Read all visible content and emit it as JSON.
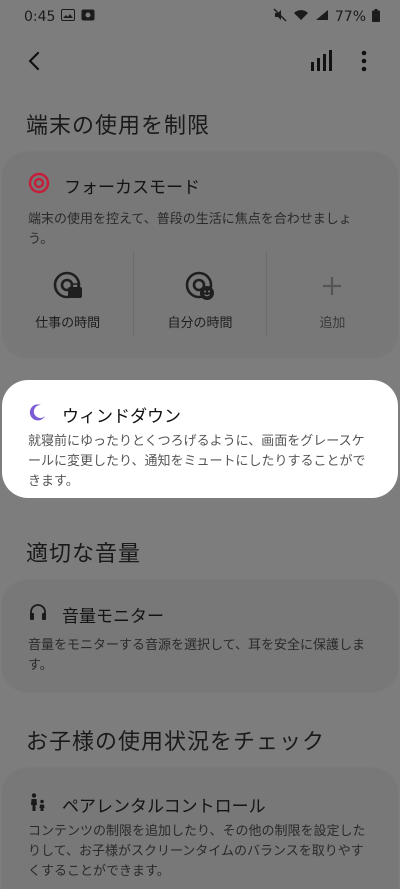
{
  "status": {
    "time": "0:45",
    "battery": "77%"
  },
  "sections": {
    "device_usage": "端末の使用を制限",
    "volume": "適切な音量",
    "kids": "お子様の使用状況をチェック"
  },
  "focus": {
    "title": "フォーカスモード",
    "desc": "端末の使用を控えて、普段の生活に焦点を合わせましょう。",
    "modes": [
      "仕事の時間",
      "自分の時間",
      "追加"
    ]
  },
  "winddown": {
    "title": "ウィンドダウン",
    "desc": "就寝前にゆったりとくつろげるように、画面をグレースケールに変更したり、通知をミュートにしたりすることができます。"
  },
  "volume_monitor": {
    "title": "音量モニター",
    "desc": "音量をモニターする音源を選択して、耳を安全に保護します。"
  },
  "parental": {
    "title": "ペアレンタルコントロール",
    "desc": "コンテンツの制限を追加したり、その他の制限を設定したりして、お子様がスクリーンタイムのバランスを取りやすくすることができます。"
  },
  "colors": {
    "dim_bg": "#7d7d7d",
    "card_bg": "#ffffff",
    "moon": "#7b5bd6",
    "target": "#c61d3a"
  }
}
